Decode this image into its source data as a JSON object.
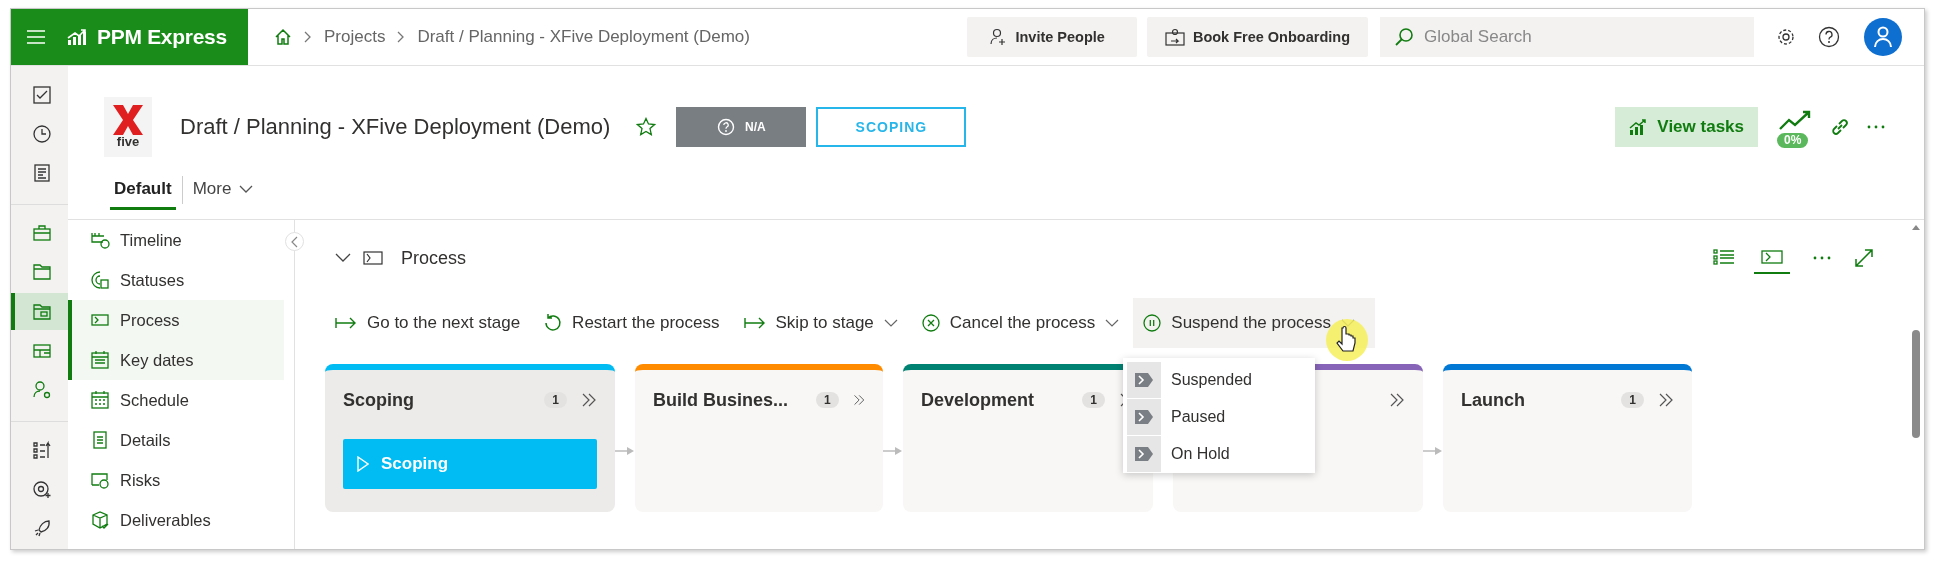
{
  "top_bar": {
    "app_name": "PPM Express",
    "breadcrumb": [
      "Projects",
      "Draft / Planning - XFive Deployment (Demo)"
    ],
    "buttons": [
      {
        "label": "Invite People",
        "kind": "invite"
      },
      {
        "label": "Book Free Onboarding",
        "kind": "onboarding"
      }
    ],
    "search": {
      "placeholder": "Global Search"
    }
  },
  "rail": [
    {
      "selected": false
    },
    {
      "selected": false
    },
    {
      "selected": false
    },
    {
      "selected": false
    },
    {
      "selected": false
    },
    {
      "selected": true
    },
    {
      "selected": false
    },
    {
      "selected": false
    },
    {
      "selected": false
    },
    {
      "selected": false
    },
    {
      "selected": false
    }
  ],
  "project": {
    "logo_caption": "five",
    "title": "Draft / Planning - XFive Deployment (Demo)",
    "favorite": false,
    "health": "N/A",
    "stage": "SCOPING",
    "view_tasks": "View tasks",
    "progress": "0%"
  },
  "tabs": [
    {
      "label": "Default",
      "selected": true
    },
    {
      "label": "More",
      "selected": false
    }
  ],
  "nav": [
    {
      "label": "Timeline",
      "selected": false
    },
    {
      "label": "Statuses",
      "selected": false
    },
    {
      "label": "Process",
      "selected": true
    },
    {
      "label": "Key dates",
      "selected": true
    },
    {
      "label": "Schedule",
      "selected": false
    },
    {
      "label": "Details",
      "selected": false
    },
    {
      "label": "Risks",
      "selected": false
    },
    {
      "label": "Deliverables",
      "selected": false
    }
  ],
  "section": {
    "title": "Process",
    "expanded": true
  },
  "view_modes": [
    {
      "selected": false
    },
    {
      "selected": true
    }
  ],
  "actions": [
    {
      "label": "Go to the next stage",
      "kind": "next",
      "dropdown": false,
      "open": false
    },
    {
      "label": "Restart the process",
      "kind": "restart",
      "dropdown": false,
      "open": false
    },
    {
      "label": "Skip to stage",
      "kind": "next",
      "dropdown": true,
      "open": false
    },
    {
      "label": "Cancel the process",
      "kind": "cancel",
      "dropdown": true,
      "open": false
    },
    {
      "label": "Suspend the process",
      "kind": "suspend",
      "dropdown": true,
      "open": true
    }
  ],
  "menu": [
    "Suspended",
    "Paused",
    "On Hold"
  ],
  "stages": [
    {
      "name": "Scoping",
      "count": "1",
      "color": "#00bcf2",
      "items": [
        "Scoping"
      ]
    },
    {
      "name": "Build Busines...",
      "count": "1",
      "color": "#ff8c00"
    },
    {
      "name": "Development",
      "count": "1",
      "color": "#008272"
    },
    {
      "color": "#8764b8"
    },
    {
      "name": "Launch",
      "count": "1",
      "color": "#0078d4"
    }
  ]
}
